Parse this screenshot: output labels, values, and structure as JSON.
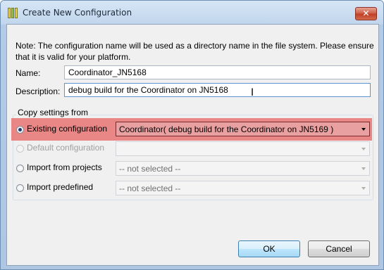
{
  "window": {
    "title": "Create New Configuration",
    "close_glyph": "✕",
    "icon": "eclipse-config-icon"
  },
  "note": "Note: The configuration name will be used as a directory name in the file system.  Please ensure that it is valid for your platform.",
  "name_field": {
    "label": "Name:",
    "value": "Coordinator_JN5168"
  },
  "description_field": {
    "label": "Description:",
    "value": "debug build for the Coordinator on JN5168"
  },
  "copy_settings": {
    "title": "Copy settings from",
    "options": [
      {
        "label": "Existing configuration",
        "selected": true,
        "enabled": true,
        "combo_value": "Coordinator( debug build for the Coordinator on JN5169 )"
      },
      {
        "label": "Default configuration",
        "selected": false,
        "enabled": false,
        "combo_value": ""
      },
      {
        "label": "Import from projects",
        "selected": false,
        "enabled": true,
        "combo_value": "-- not selected --"
      },
      {
        "label": "Import predefined",
        "selected": false,
        "enabled": true,
        "combo_value": "-- not selected --"
      }
    ],
    "highlight_color": "#e87373"
  },
  "buttons": {
    "ok": "OK",
    "cancel": "Cancel"
  },
  "ibeam_glyph": "I"
}
